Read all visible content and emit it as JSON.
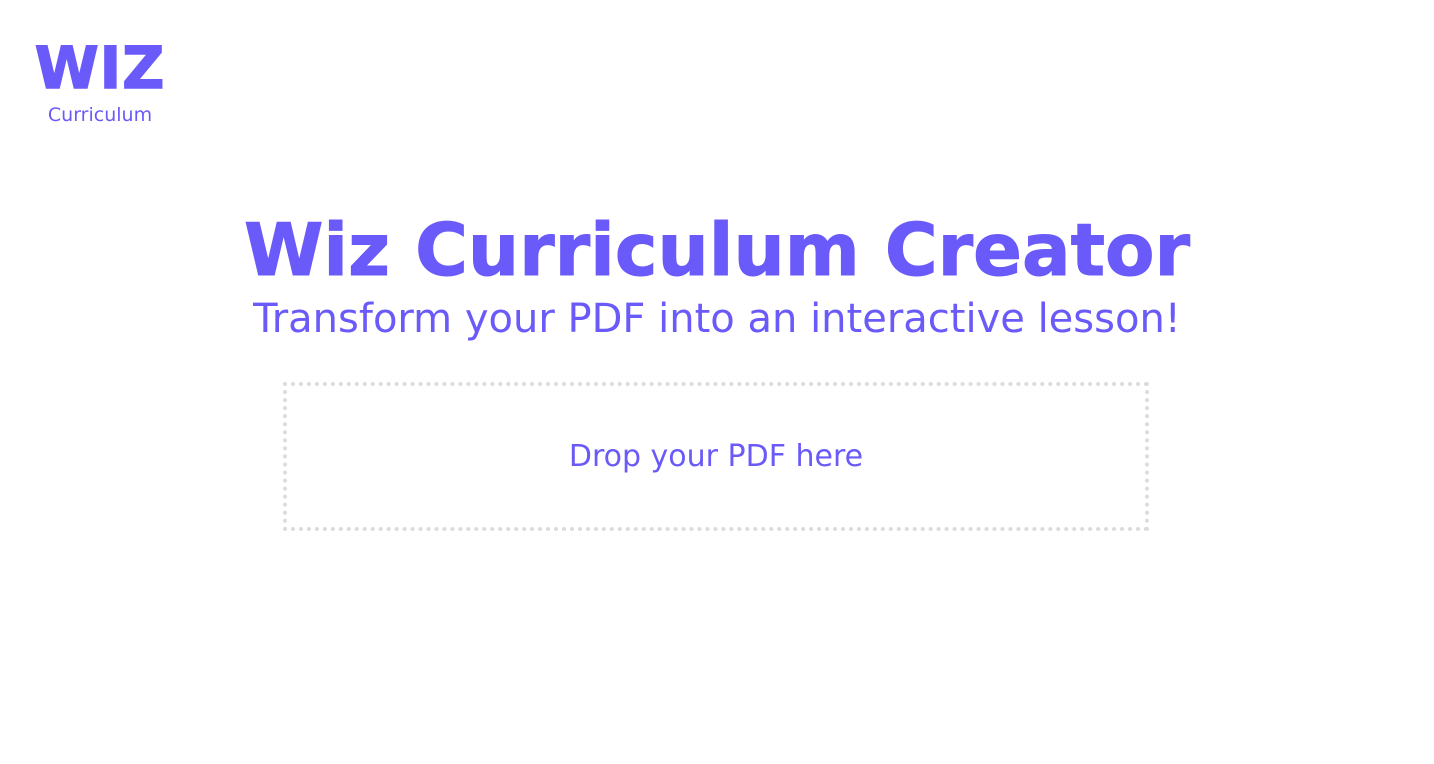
{
  "colors": {
    "brand": "#6a5af9",
    "dropzone_border": "#dcdcdc",
    "background": "#ffffff"
  },
  "logo": {
    "mark": "WIZ",
    "subtitle": "Curriculum"
  },
  "hero": {
    "title": "Wiz Curriculum Creator",
    "subtitle": "Transform your PDF into an interactive lesson!"
  },
  "dropzone": {
    "label": "Drop your PDF here"
  }
}
